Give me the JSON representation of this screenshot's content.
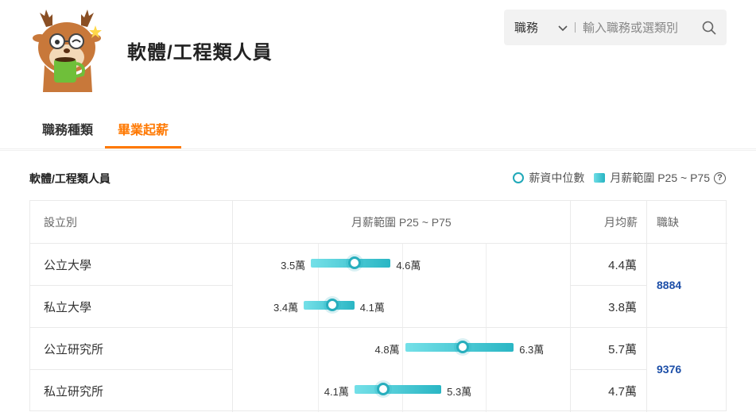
{
  "header": {
    "title": "軟體/工程類人員"
  },
  "search": {
    "category": "職務",
    "placeholder": "輸入職務或選類別"
  },
  "tabs": [
    {
      "label": "職務種類",
      "active": false
    },
    {
      "label": "畢業起薪",
      "active": true
    }
  ],
  "section": {
    "title": "軟體/工程類人員",
    "legend": {
      "median": "薪資中位數",
      "range": "月薪範圍 P25 ~ P75",
      "help": "?"
    }
  },
  "table": {
    "headers": {
      "type": "設立別",
      "range": "月薪範圍 P25 ~ P75",
      "avg": "月均薪",
      "vacancies": "職缺"
    },
    "rows": [
      {
        "label": "公立大學",
        "p25": 3.5,
        "p25_label": "3.5萬",
        "median": 4.1,
        "p75": 4.6,
        "p75_label": "4.6萬",
        "avg": "4.4萬"
      },
      {
        "label": "私立大學",
        "p25": 3.4,
        "p25_label": "3.4萬",
        "median": 3.8,
        "p75": 4.1,
        "p75_label": "4.1萬",
        "avg": "3.8萬"
      },
      {
        "label": "公立研究所",
        "p25": 4.8,
        "p25_label": "4.8萬",
        "median": 5.6,
        "p75": 6.3,
        "p75_label": "6.3萬",
        "avg": "5.7萬"
      },
      {
        "label": "私立研究所",
        "p25": 4.1,
        "p25_label": "4.1萬",
        "median": 4.5,
        "p75": 5.3,
        "p75_label": "5.3萬",
        "avg": "4.7萬"
      }
    ],
    "vacancies": [
      {
        "value": "8884",
        "rows": "公立大學, 私立大學"
      },
      {
        "value": "9376",
        "rows": "公立研究所, 私立研究所"
      }
    ]
  },
  "colors": {
    "accent": "#ff7800",
    "bar": "#2ab6c4",
    "vacancy": "#1d4fa8"
  }
}
